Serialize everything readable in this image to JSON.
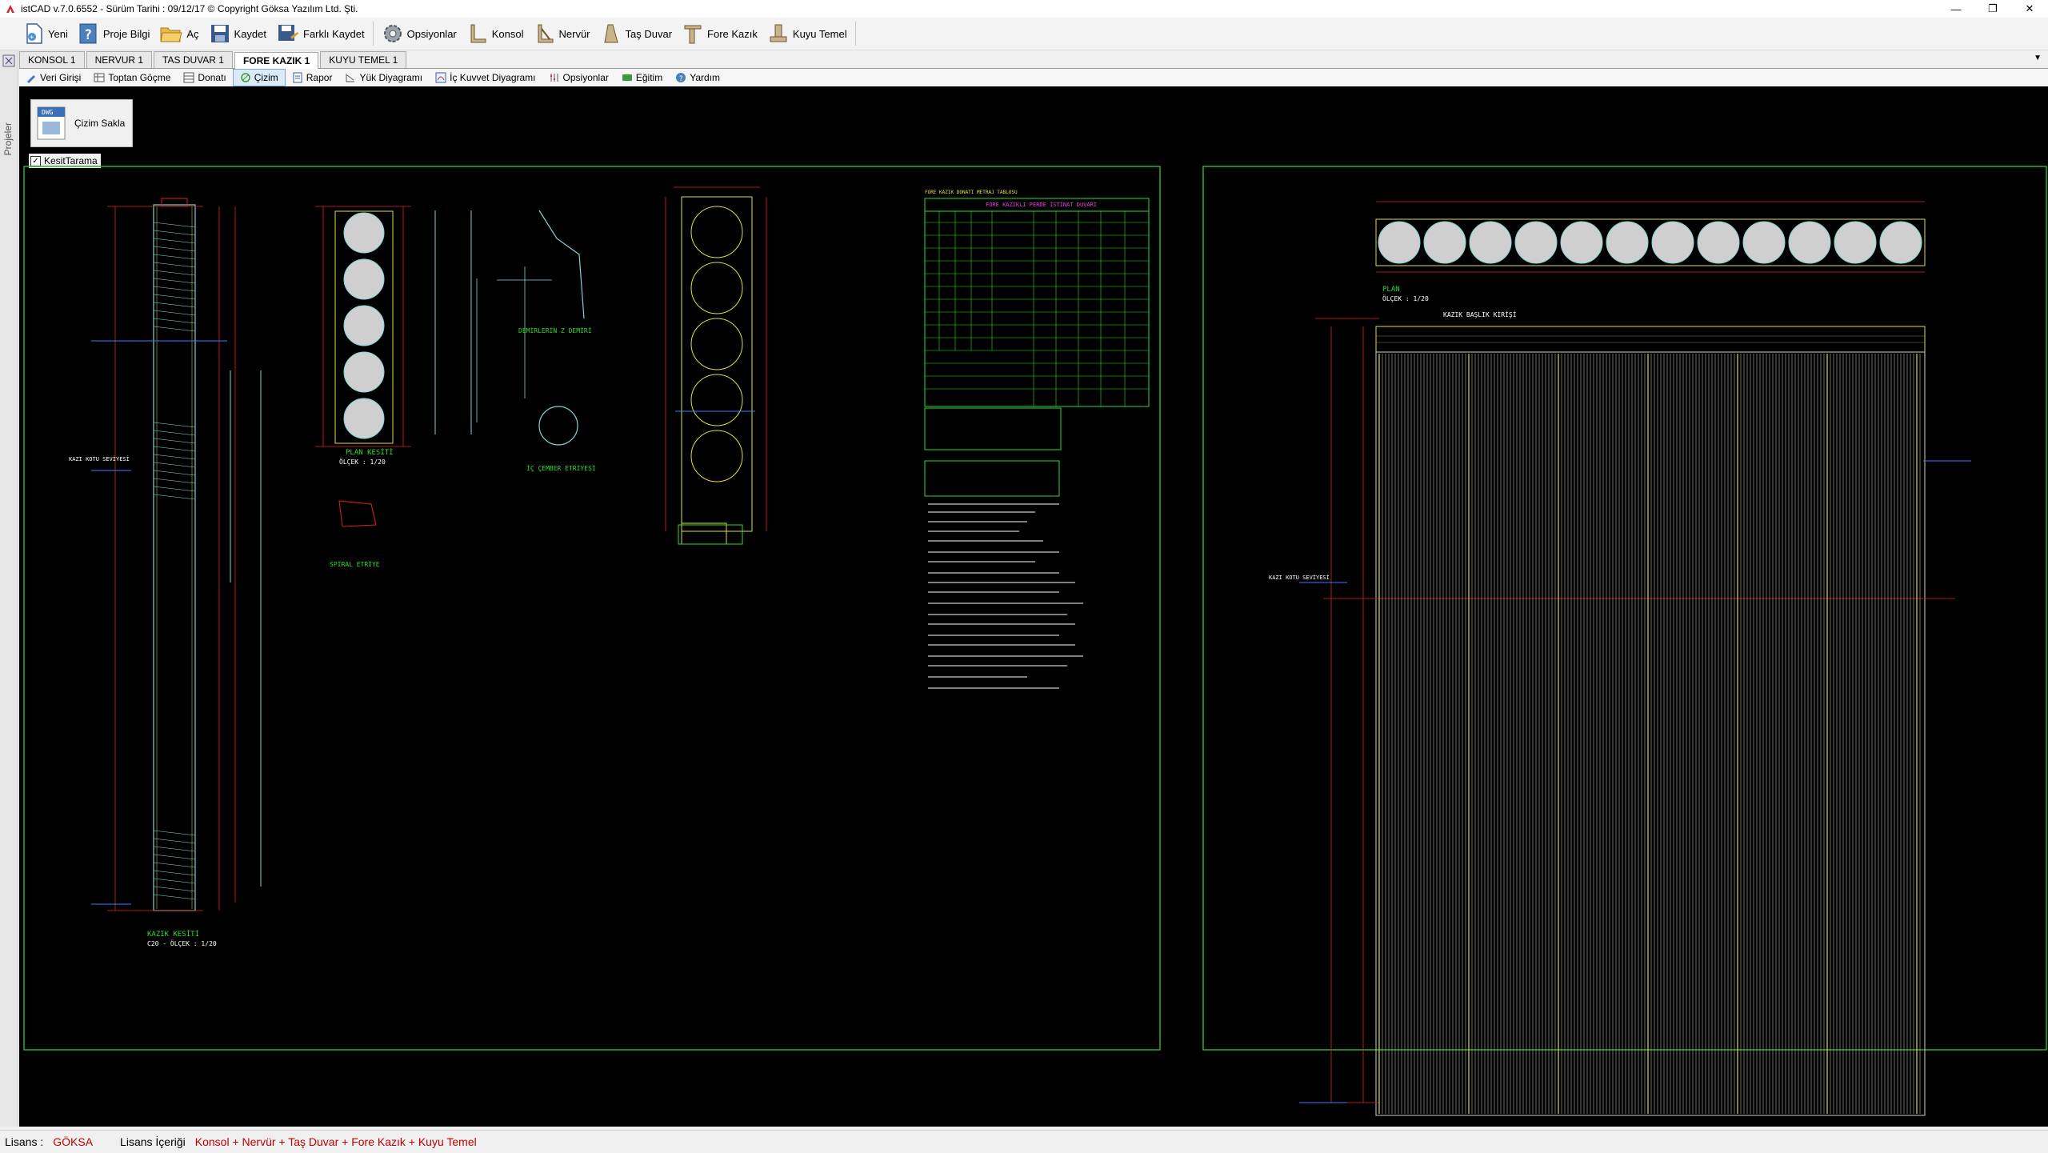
{
  "window": {
    "title": "istCAD v.7.0.6552 -  Sürüm Tarihi : 09/12/17  © Copyright Göksa Yazılım Ltd. Şti.",
    "minimize": "—",
    "restore": "❐",
    "close": "✕"
  },
  "toolbar": {
    "items": [
      {
        "label": "Yeni",
        "icon": "new-file-icon"
      },
      {
        "label": "Proje Bilgi",
        "icon": "help-icon"
      },
      {
        "label": "Aç",
        "icon": "folder-open-icon"
      },
      {
        "label": "Kaydet",
        "icon": "save-icon"
      },
      {
        "label": "Farklı Kaydet",
        "icon": "save-as-icon"
      },
      {
        "label": "Opsiyonlar",
        "icon": "gear-icon"
      },
      {
        "label": "Konsol",
        "icon": "konsol-icon"
      },
      {
        "label": "Nervür",
        "icon": "nervur-icon"
      },
      {
        "label": "Taş Duvar",
        "icon": "tas-duvar-icon"
      },
      {
        "label": "Fore Kazık",
        "icon": "fore-kazik-icon"
      },
      {
        "label": "Kuyu Temel",
        "icon": "kuyu-temel-icon"
      }
    ]
  },
  "side_panel": {
    "label": "Projeler"
  },
  "tabs": [
    {
      "label": "KONSOL 1",
      "active": false
    },
    {
      "label": "NERVUR 1",
      "active": false
    },
    {
      "label": "TAS DUVAR 1",
      "active": false
    },
    {
      "label": "FORE KAZIK 1",
      "active": true
    },
    {
      "label": "KUYU TEMEL 1",
      "active": false
    }
  ],
  "tabs_dropdown": "▼",
  "subtoolbar": {
    "items": [
      {
        "label": "Veri Girişi",
        "active": false
      },
      {
        "label": "Toptan Göçme",
        "active": false
      },
      {
        "label": "Donatı",
        "active": false
      },
      {
        "label": "Çizim",
        "active": true
      },
      {
        "label": "Rapor",
        "active": false
      },
      {
        "label": "Yük Diyagramı",
        "active": false
      },
      {
        "label": "İç Kuvvet Diyagramı",
        "active": false
      },
      {
        "label": "Opsiyonlar",
        "active": false
      },
      {
        "label": "Eğitim",
        "active": false
      },
      {
        "label": "Yardım",
        "active": false
      }
    ]
  },
  "canvas": {
    "save_button_label": "Çizim Sakla",
    "save_button_icon_text": "DWG",
    "checkbox_label": "KesitTarama",
    "checkbox_checked": true,
    "drawing_left": {
      "label_pile_section": "KAZIK KESİTİ",
      "label_scale_1_20": "ÖLÇEK : 1/20",
      "label_c20_scale": "C20 - ÖLÇEK : 1/20",
      "label_spiral": "SPİRAL ETRİYE",
      "label_round_stirrup": "İÇ ÇEMBER ETRİYESİ",
      "label_plan_section": "PLAN KESİTİ",
      "label_excavation": "KAZI KOTU SEVİYESİ",
      "label_flex_bar": "DEMİRLERİN Z DEMİRİ",
      "table_title": "FORE KAZIKLI PERDE İSTİNAT DUVARI",
      "table_small_title": "FORE KAZIK DONATI METRAJ TABLOSU"
    },
    "drawing_right": {
      "label_cap_beam": "KAZIK BAŞLIK KİRİŞİ",
      "label_plan": "PLAN",
      "label_scale": "ÖLÇEK : 1/20",
      "label_excavation": "KAZI KOTU SEVİYESİ"
    }
  },
  "status": {
    "license_label": "Lisans :",
    "license_value": "GÖKSA",
    "content_label": "Lisans İçeriği",
    "content_value": "Konsol + Nervür + Taş Duvar + Fore Kazık + Kuyu Temel"
  },
  "colors": {
    "cad_background": "#000000",
    "frame_green": "#2fae2f",
    "dim_red": "#e02020",
    "pile_cyan": "#7fd6d6",
    "label_green": "#2fdc2f",
    "label_magenta": "#e040e0",
    "cap_yellow": "#e0e040",
    "level_blue": "#3a7cff",
    "status_red": "#c00000"
  }
}
